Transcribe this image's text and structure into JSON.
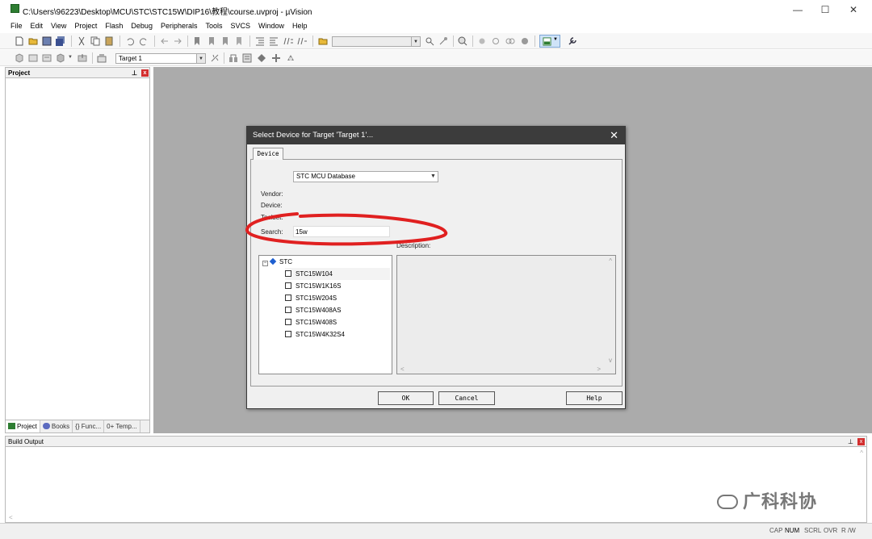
{
  "window": {
    "title": "C:\\Users\\96223\\Desktop\\MCU\\STC\\STC15W\\DIP16\\教程\\course.uvproj - µVision",
    "minimize": "—",
    "maximize": "☐",
    "close": "✕"
  },
  "menu": [
    "File",
    "Edit",
    "View",
    "Project",
    "Flash",
    "Debug",
    "Peripherals",
    "Tools",
    "SVCS",
    "Window",
    "Help"
  ],
  "toolbar2": {
    "target": "Target 1"
  },
  "project_panel": {
    "title": "Project",
    "tabs": [
      "Project",
      "Books",
      "{} Func...",
      "0+ Temp..."
    ]
  },
  "dialog": {
    "title": "Select Device for Target 'Target 1'...",
    "tab": "Device",
    "database": "STC MCU Database",
    "labels": {
      "vendor": "Vendor:",
      "device": "Device:",
      "toolset": "Toolset:",
      "search": "Search:",
      "description": "Description:"
    },
    "search_value": "15w",
    "tree_root": "STC",
    "devices": [
      "STC15W104",
      "STC15W1K16S",
      "STC15W204S",
      "STC15W408AS",
      "STC15W408S",
      "STC15W4K32S4"
    ],
    "buttons": {
      "ok": "OK",
      "cancel": "Cancel",
      "help": "Help"
    }
  },
  "build_output": {
    "title": "Build Output"
  },
  "statusbar": [
    "CAP",
    "NUM",
    "SCRL",
    "OVR",
    "R /W"
  ],
  "watermark": "广科科协",
  "colors": {
    "annotation": "#e02020",
    "workspace": "#ababab",
    "dialog_title": "#3c3c3c"
  }
}
